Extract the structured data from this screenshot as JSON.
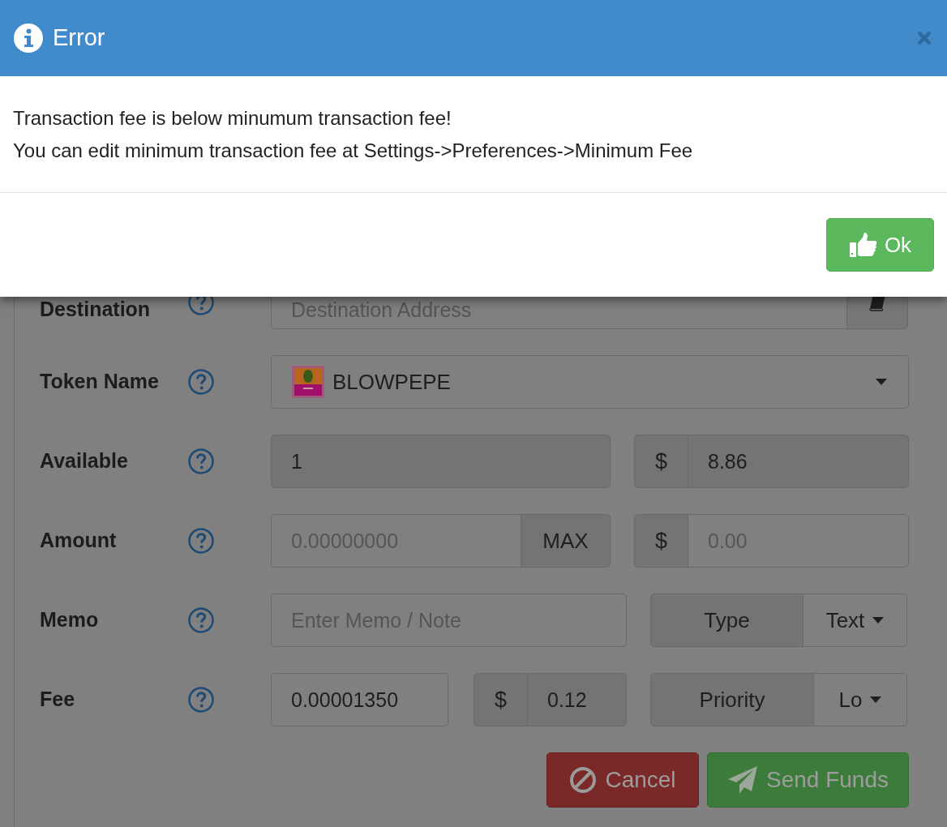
{
  "dialog": {
    "title": "Error",
    "message_lines": [
      "Transaction fee is below minumum transaction fee!",
      "You can edit minimum transaction fee at Settings->Preferences->Minimum Fee"
    ],
    "ok_label": "Ok"
  },
  "form": {
    "rows": [
      {
        "kind": "address",
        "label": "Destination",
        "placeholder": "Destination Address"
      },
      {
        "kind": "token",
        "label": "Token Name",
        "value": "BLOWPEPE"
      },
      {
        "kind": "available",
        "label": "Available",
        "amount": {
          "value": "1",
          "disabled": true
        },
        "usd": {
          "prefix": "$",
          "value": "8.86",
          "disabled": true
        }
      },
      {
        "kind": "amount",
        "label": "Amount",
        "amount": {
          "placeholder": "0.00000000",
          "disabled": false
        },
        "max_label": "MAX",
        "usd": {
          "prefix": "$",
          "placeholder": "0.00",
          "disabled": false
        }
      },
      {
        "kind": "memo",
        "label": "Memo",
        "placeholder": "Enter Memo / Note",
        "addon": "Type",
        "dropdown": "Text"
      },
      {
        "kind": "fee",
        "label": "Fee",
        "amount": {
          "value": "0.00001350",
          "disabled": false
        },
        "usd": {
          "prefix": "$",
          "value": "0.12",
          "disabled": true
        },
        "addon": "Priority",
        "dropdown": "Lo"
      }
    ],
    "actions": [
      {
        "kind": "cancel",
        "label": "Cancel"
      },
      {
        "kind": "send",
        "label": "Send Funds"
      }
    ]
  }
}
